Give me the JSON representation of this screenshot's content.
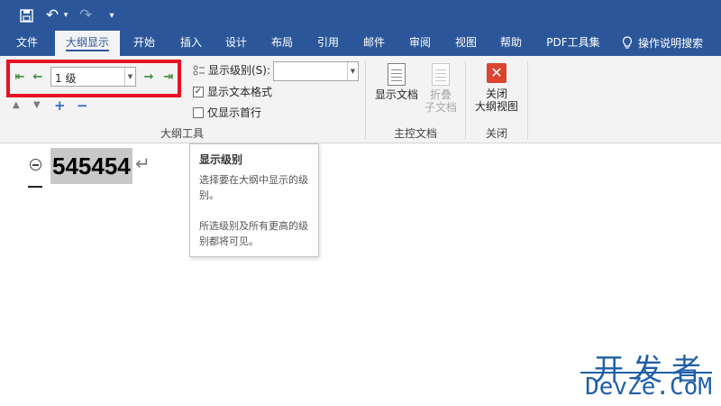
{
  "qat": {
    "undo_glyph": "↶",
    "redo_glyph": "↷",
    "customize_glyph": "▾"
  },
  "tabs": [
    {
      "label": "文件"
    },
    {
      "label": "大纲显示",
      "active": true
    },
    {
      "label": "开始"
    },
    {
      "label": "插入"
    },
    {
      "label": "设计"
    },
    {
      "label": "布局"
    },
    {
      "label": "引用"
    },
    {
      "label": "邮件"
    },
    {
      "label": "审阅"
    },
    {
      "label": "视图"
    },
    {
      "label": "帮助"
    },
    {
      "label": "PDF工具集"
    }
  ],
  "tell_me": "操作说明搜索",
  "outline_tools": {
    "level_value": "1 级",
    "show_level_label": "显示级别(S):",
    "show_level_value": "",
    "show_text_formatting": {
      "label": "显示文本格式",
      "checked": true
    },
    "show_first_line_only": {
      "label": "仅显示首行",
      "checked": false
    },
    "group_label": "大纲工具"
  },
  "master_document": {
    "show_document": "显示文档",
    "collapse_subdocs_line1": "折叠",
    "collapse_subdocs_line2": "子文档",
    "group_label": "主控文档"
  },
  "close": {
    "close_line1": "关闭",
    "close_line2": "大纲视图",
    "group_label": "关闭"
  },
  "document": {
    "heading_text": "545454"
  },
  "tooltip": {
    "title": "显示级别",
    "body1": "选择要在大纲中显示的级别。",
    "body2": "所选级别及所有更高的级别都将可见。"
  },
  "watermark": {
    "cn": "开发者",
    "en": "DevZe.CoM"
  },
  "colors": {
    "ribbon_blue": "#2b579a",
    "highlight_red": "#e81123",
    "watermark_blue": "#1f5fa8"
  }
}
